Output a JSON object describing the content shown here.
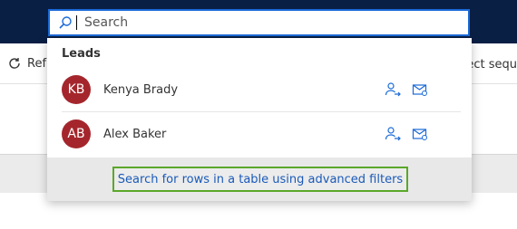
{
  "toolbar": {
    "refresh_label": "Refr",
    "right_text": "ect sequ"
  },
  "search": {
    "placeholder": "Search",
    "value": ""
  },
  "dropdown": {
    "group_title": "Leads",
    "results": [
      {
        "initials": "KB",
        "name": "Kenya Brady",
        "avatar_color": "#a4262c"
      },
      {
        "initials": "AB",
        "name": "Alex Baker",
        "avatar_color": "#a4262c"
      }
    ],
    "advanced_link": "Search for rows in a table using advanced filters"
  },
  "colors": {
    "topbar": "#0a1f44",
    "accent": "#1a6ad8",
    "highlight": "#5aa82a"
  },
  "icons": {
    "search": "search-icon",
    "assign": "assign-person-icon",
    "email": "email-icon",
    "refresh": "refresh-icon"
  }
}
